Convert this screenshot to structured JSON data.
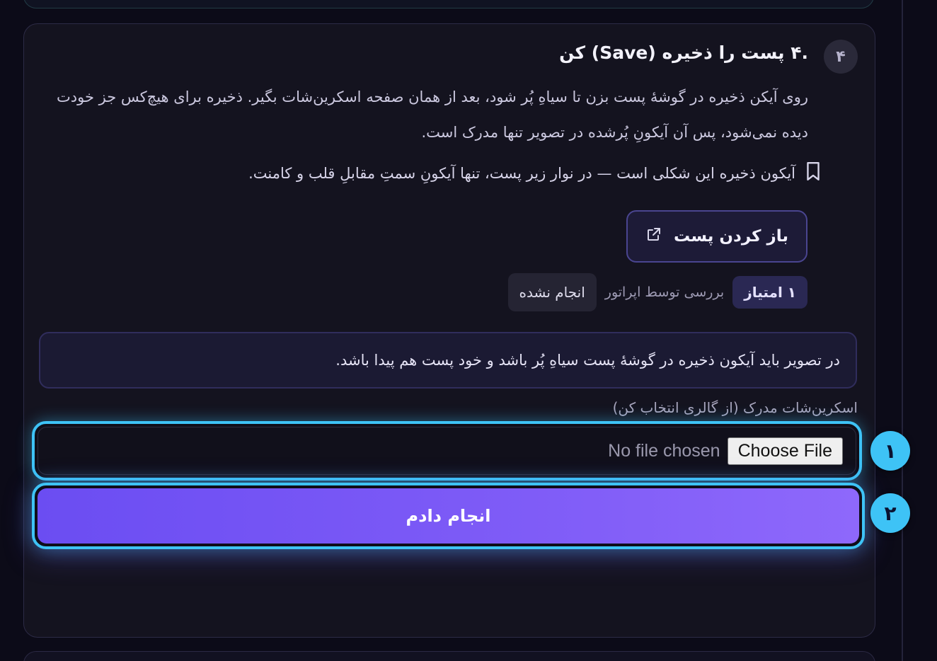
{
  "step": {
    "number": "۴",
    "title": ".۴ پست را ذخیره (Save) کن",
    "description": "روی آیکن ذخیره در گوشهٔ پست بزن تا سیاهِ پُر شود، بعد از همان صفحه اسکرین‌شات بگیر. ذخیره برای هیچ‌کس جز خودت دیده نمی‌شود، پس آن آیکونِ پُرشده در تصویر تنها مدرک است.",
    "bookmark_note": "آیکون ذخیره این شکلی است — در نوار زیر پست، تنها آیکونِ سمتِ مقابلِ قلب و کامنت.",
    "open_post_label": "باز کردن پست",
    "points_label": "۱ امتیاز",
    "reviewer_label": "بررسی توسط اپراتور",
    "status_label": "انجام نشده",
    "hint": "در تصویر باید آیکون ذخیره در گوشهٔ پست سیاهِ پُر باشد و خود پست هم پیدا باشد.",
    "upload_label": "اسکرین‌شات مدرک (از گالری انتخاب کن)",
    "file_input": {
      "button_label": "Choose File",
      "status": "No file chosen"
    },
    "submit_label": "انجام دادم"
  },
  "badges": {
    "file_input": "۱",
    "submit": "۲"
  },
  "colors": {
    "highlight": "#3ec3f6",
    "accent": "#7b5bf6",
    "card_bg": "#14131f"
  },
  "icons": {
    "bookmark": "bookmark-icon",
    "external_link": "external-link-icon"
  }
}
